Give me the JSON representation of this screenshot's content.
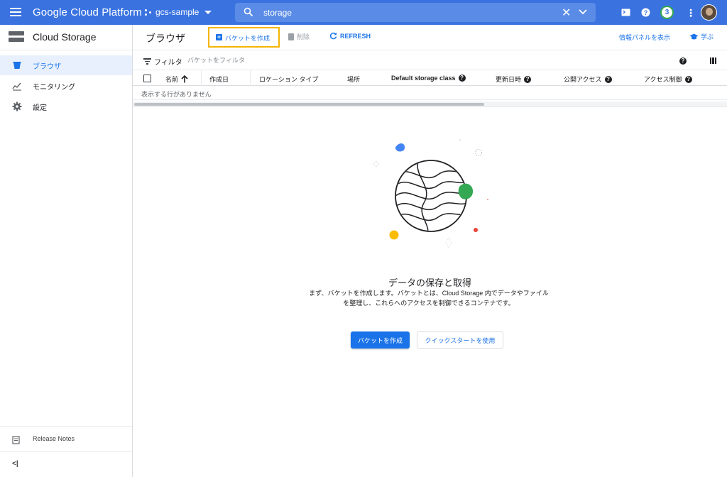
{
  "topbar": {
    "brand": "Google Cloud Platform",
    "project": "gcs-sample",
    "search_value": "storage",
    "notification_count": "3",
    "bar_color": "#3a73e0"
  },
  "sidebar": {
    "title": "Cloud Storage",
    "items": [
      {
        "label": "ブラウザ",
        "icon": "bucket-icon",
        "active": true
      },
      {
        "label": "モニタリング",
        "icon": "chart-icon",
        "active": false
      },
      {
        "label": "設定",
        "icon": "gear-icon",
        "active": false
      }
    ],
    "release_notes": "Release Notes",
    "collapse": "<|"
  },
  "toolbar": {
    "title": "ブラウザ",
    "create_label": "バケットを作成",
    "delete_label": "削除",
    "refresh_label": "REFRESH",
    "info_panel_label": "情報パネルを表示",
    "learn_label": "学ぶ"
  },
  "filter": {
    "label": "フィルタ",
    "placeholder": "バケットをフィルタ"
  },
  "table": {
    "columns": [
      "名前",
      "作成日",
      "ロケーション タイプ",
      "場所",
      "Default storage class",
      "更新日時",
      "公開アクセス",
      "アクセス制御"
    ],
    "empty_text": "表示する行がありません"
  },
  "empty_state": {
    "title": "データの保存と取得",
    "description": "まず、バケットを作成します。バケットとは、Cloud Storage 内でデータやファイルを整理し、これらへのアクセスを制御できるコンテナです。",
    "primary_button": "バケットを作成",
    "secondary_button": "クイックスタートを使用"
  },
  "colors": {
    "accent": "#1a73e8",
    "highlight": "#f4b400",
    "green": "#34a853",
    "blue_blob": "#4285f4",
    "yellow_blob": "#fbbc04",
    "red_dot": "#ea4335"
  }
}
